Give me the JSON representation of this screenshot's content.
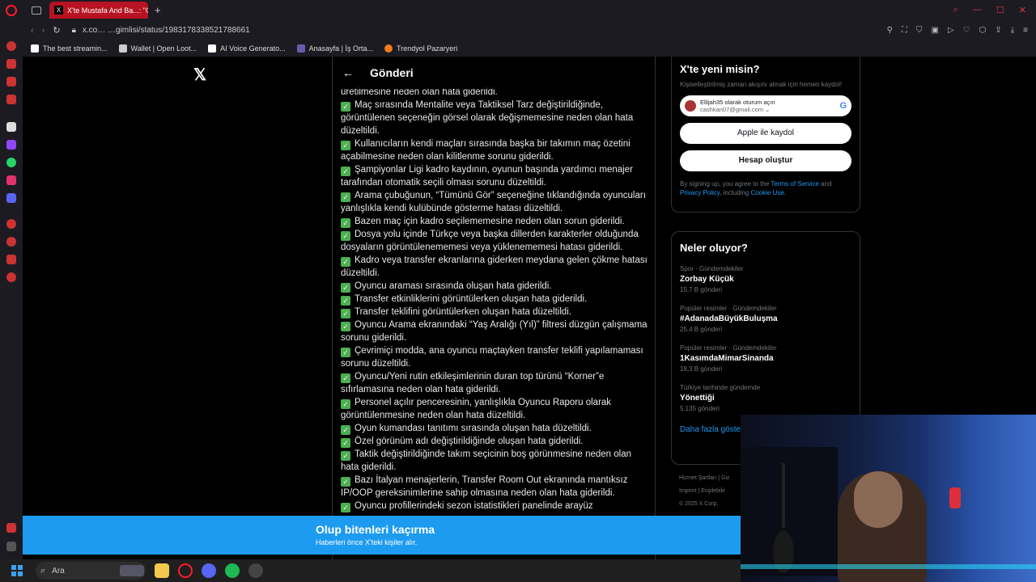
{
  "browser": {
    "tab_title": "X'te Mustafa And Ba...: \"G",
    "tab_favicon": "X",
    "tab_close": "×",
    "new_tab": "+",
    "url": "x.co… …gimlisi/status/1983178338521788661",
    "bookmarks": [
      {
        "label": "The best streamin...",
        "color": "#ffffff"
      },
      {
        "label": "Wallet | Open Loot...",
        "color": "#cccccc"
      },
      {
        "label": "AI Voice Generato...",
        "color": "#ffffff"
      },
      {
        "label": "Anasayfa | İş Orta...",
        "color": "#6b5ba8"
      },
      {
        "label": "Trendyol Pazaryeri",
        "color": "#f27a1a"
      }
    ]
  },
  "header": {
    "x_logo": "𝕏",
    "back_arrow": "←",
    "title": "Gönderi"
  },
  "post": {
    "checkmark": "✓",
    "first_line": "üretilmesine neden olan hata giderildi.",
    "items": [
      "Maç sırasında Mentalite veya Taktiksel Tarz değiştirildiğinde, görüntülenen seçeneğin görsel olarak değişmemesine neden olan hata düzeltildi.",
      "Kullanıcıların kendi maçları sırasında başka bir takımın maç özetini açabilmesine neden olan kilitlenme sorunu giderildi.",
      "Şampiyonlar Ligi kadro kaydının, oyunun başında yardımcı menajer tarafından otomatik seçili olması sorunu düzeltildi.",
      "Arama çubuğunun, “Tümünü Gör” seçeneğine tıklandığında oyuncuları yanlışlıkla kendi kulübünde gösterme hatası düzeltildi.",
      "Bazen maç için kadro seçilememesine neden olan sorun giderildi.",
      "Dosya yolu içinde Türkçe veya başka dillerden karakterler olduğunda dosyaların görüntülenememesi veya yüklenememesi hatası giderildi.",
      "Kadro veya transfer ekranlarına giderken meydana gelen çökme hatası düzeltildi.",
      "Oyuncu araması sırasında oluşan hata giderildi.",
      "Transfer etkinliklerini görüntülerken oluşan hata giderildi.",
      "Transfer teklifini görüntülerken oluşan hata düzeltildi.",
      "Oyuncu Arama ekranındaki “Yaş Aralığı (Yıl)” filtresi düzgün çalışmama sorunu giderildi.",
      "Çevrimiçi modda, ana oyuncu maçtayken transfer teklifi yapılamaması sorunu düzeltildi.",
      "Oyuncu/Yeni rutin etkileşimlerinin duran top türünü “Korner”e sıfırlamasına neden olan hata giderildi.",
      "Personel açılır penceresinin, yanlışlıkla Oyuncu Raporu olarak görüntülenmesine neden olan hata düzeltildi.",
      "Oyun kumandası tanıtımı sırasında oluşan hata düzeltildi.",
      "Özel görünüm adı değiştirildiğinde oluşan hata giderildi.",
      "Taktik değiştirildiğinde takım seçicinin boş görünmesine neden olan hata giderildi.",
      "Bazı İtalyan menajerlerin, Transfer Room Out ekranında mantıksız IP/OOP gereksinimlerine sahip olmasına neden olan hata giderildi.",
      "Oyuncu profillerindeki sezon istatistikleri panelinde arayüz"
    ]
  },
  "signup": {
    "title": "X'te yeni misin?",
    "subtitle": "Kişiselleştirilmiş zaman akışını almak için hemen kaydol!",
    "google_name": "Ellijah35 olarak oturum açın",
    "google_email": "cashkan07@gmail.com ⌄",
    "google_logo": "G",
    "apple_button": " Apple ile kaydol",
    "create_button": "Hesap oluştur",
    "legal_prefix": "By signing up, you agree to the ",
    "terms": "Terms of Service",
    "and": " and ",
    "privacy": "Privacy Policy",
    "including": ", including ",
    "cookie": "Cookie Use."
  },
  "trends": {
    "title": "Neler oluyor?",
    "items": [
      {
        "meta": "Spor · Gündemdekiler",
        "name": "Zorbay Küçük",
        "count": "15,7 B gönderi"
      },
      {
        "meta": "Popüler resimler · Gündemdekiler",
        "name": "#AdanadaBüyükBuluşma",
        "count": "25,4 B gönderi"
      },
      {
        "meta": "Popüler resimler · Gündemdekiler",
        "name": "1KasımdaMimarSinanda",
        "count": "18,3 B gönderi"
      },
      {
        "meta": "Türkiye tarihinde gündemde",
        "name": "Yönettiği",
        "count": "5.135 gönderi"
      }
    ],
    "show_more": "Daha fazla göste"
  },
  "footer": {
    "links": [
      "Hizmet Şartları  |  Giz",
      "İmprint  |  Erişilebilir",
      "© 2025 X Corp."
    ]
  },
  "banner": {
    "title": "Olup bitenleri kaçırma",
    "subtitle": "Haberleri önce X'teki kişiler alır."
  },
  "taskbar": {
    "search_placeholder": "Ara",
    "search_icon": "⌕"
  }
}
